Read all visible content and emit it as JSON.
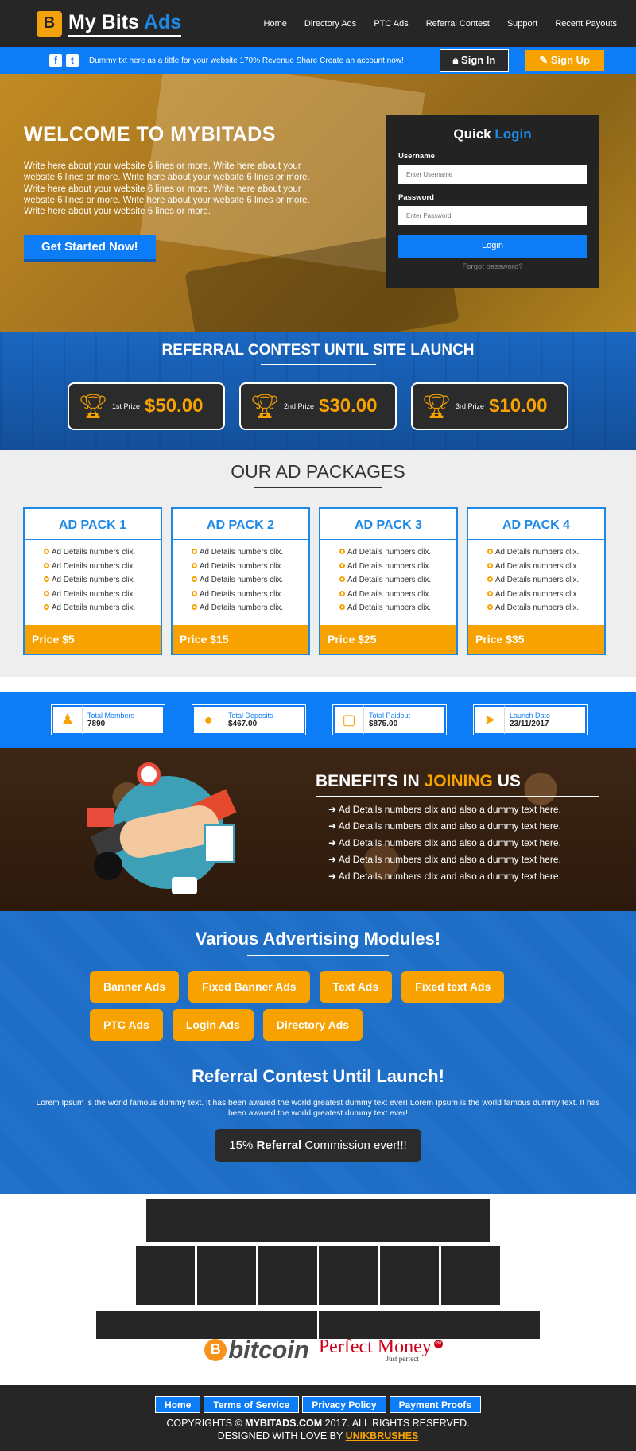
{
  "header": {
    "logo_glyph": "B",
    "brand_1": "My Bits ",
    "brand_2": "Ads",
    "nav": [
      "Home",
      "Directory Ads",
      "PTC Ads",
      "Referral Contest",
      "Support",
      "Recent Payouts"
    ]
  },
  "topbar": {
    "social": [
      "f",
      "t"
    ],
    "text": "Dummy txt here as a tittle for your website 170% Revenue Share Create an account now!",
    "signin": "Sign In",
    "signup": "Sign Up"
  },
  "hero": {
    "title": "WELCOME TO MYBITADS",
    "text": "Write here about your website 6 lines or more. Write here about your website 6 lines or more. Write here about your website 6 lines or more. Write here about your website 6 lines or more. Write here about your website 6 lines or more. Write here about your website 6 lines or more. Write here about your website 6 lines or more.",
    "cta": "Get Started Now!"
  },
  "login": {
    "title_1": "Quick ",
    "title_2": "Login",
    "username_label": "Username",
    "username_placeholder": "Enter Username",
    "password_label": "Password",
    "password_placeholder": "Enter Password",
    "button": "Login",
    "forgot": "Forgot password?"
  },
  "contest": {
    "title": "REFERRAL CONTEST UNTIL SITE LAUNCH",
    "prizes": [
      {
        "label": "1st Prize",
        "value": "$50.00"
      },
      {
        "label": "2nd Prize",
        "value": "$30.00"
      },
      {
        "label": "3rd Prize",
        "value": "$10.00"
      }
    ]
  },
  "packages": {
    "title": "OUR AD PACKAGES",
    "items": [
      {
        "title": "AD PACK 1",
        "price": "Price $5",
        "details": [
          "Ad Details numbers clix.",
          "Ad Details numbers clix.",
          "Ad Details numbers clix.",
          "Ad Details numbers clix.",
          "Ad Details numbers clix."
        ]
      },
      {
        "title": "AD PACK 2",
        "price": "Price $15",
        "details": [
          "Ad Details numbers clix.",
          "Ad Details numbers clix.",
          "Ad Details numbers clix.",
          "Ad Details numbers clix.",
          "Ad Details numbers clix."
        ]
      },
      {
        "title": "AD PACK 3",
        "price": "Price $25",
        "details": [
          "Ad Details numbers clix.",
          "Ad Details numbers clix.",
          "Ad Details numbers clix.",
          "Ad Details numbers clix.",
          "Ad Details numbers clix."
        ]
      },
      {
        "title": "AD PACK 4",
        "price": "Price $35",
        "details": [
          "Ad Details numbers clix.",
          "Ad Details numbers clix.",
          "Ad Details numbers clix.",
          "Ad Details numbers clix.",
          "Ad Details numbers clix."
        ]
      }
    ]
  },
  "stats": [
    {
      "icon": "users-icon",
      "label": "Total Members",
      "value": "7890"
    },
    {
      "icon": "coins-icon",
      "label": "Total Deposits",
      "value": "$467.00"
    },
    {
      "icon": "money-icon",
      "label": "Total Paidout",
      "value": "$875.00"
    },
    {
      "icon": "rocket-icon",
      "label": "Launch Date",
      "value": "23/11/2017"
    }
  ],
  "benefits": {
    "title_1": "BENEFITS IN ",
    "title_2": "JOINING",
    "title_3": " US",
    "items": [
      "Ad Details numbers clix and also a dummy text here.",
      "Ad Details numbers clix and also a dummy text here.",
      "Ad Details numbers clix and also a dummy text here.",
      "Ad Details numbers clix and also a dummy text here.",
      "Ad Details numbers clix and also a dummy text here."
    ]
  },
  "modules": {
    "title": "Various Advertising Modules!",
    "row1": [
      "Banner Ads",
      "Fixed Banner Ads",
      "Text Ads",
      "Fixed text Ads"
    ],
    "row2": [
      "PTC Ads",
      "Login Ads",
      "Directory Ads"
    ],
    "ref_title": "Referral Contest Until Launch!",
    "ref_text": "Lorem Ipsum is the world famous dummy text. It has been awared the world greatest dummy text ever! Lorem Ipsum is the world famous dummy text. It has been awared the world greatest dummy text ever!",
    "commission_1": "15% ",
    "commission_2": "Referral",
    "commission_3": " Commission ever!!!"
  },
  "payments": {
    "btc_glyph": "B",
    "bitcoin": "bitcoin",
    "pm": "Perfect Money",
    "pm_sub": "Just perfect",
    "pm_badge": "PM"
  },
  "footer": {
    "links": [
      "Home",
      "Terms of Service",
      "Privacy Policy",
      "Payment Proofs"
    ],
    "copy_1": "COPYRIGHTS © ",
    "copy_site": "MYBITADS.COM",
    "copy_2": " 2017. ALL RIGHTS RESERVED.",
    "designed": "DESIGNED WITH LOVE BY ",
    "designer": "UNIKBRUSHES"
  }
}
